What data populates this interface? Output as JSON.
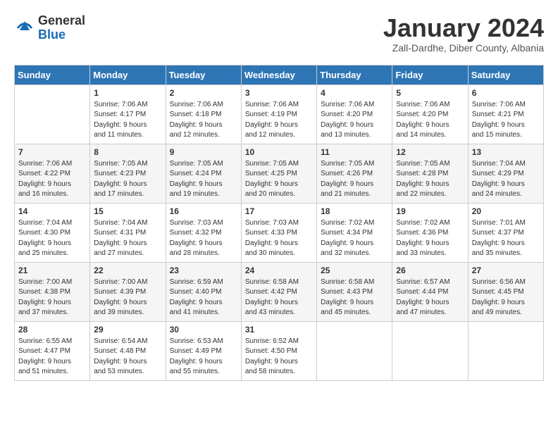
{
  "logo": {
    "general": "General",
    "blue": "Blue"
  },
  "title": "January 2024",
  "location": "Zall-Dardhe, Diber County, Albania",
  "days_of_week": [
    "Sunday",
    "Monday",
    "Tuesday",
    "Wednesday",
    "Thursday",
    "Friday",
    "Saturday"
  ],
  "weeks": [
    [
      {
        "day": "",
        "info": ""
      },
      {
        "day": "1",
        "info": "Sunrise: 7:06 AM\nSunset: 4:17 PM\nDaylight: 9 hours\nand 11 minutes."
      },
      {
        "day": "2",
        "info": "Sunrise: 7:06 AM\nSunset: 4:18 PM\nDaylight: 9 hours\nand 12 minutes."
      },
      {
        "day": "3",
        "info": "Sunrise: 7:06 AM\nSunset: 4:19 PM\nDaylight: 9 hours\nand 12 minutes."
      },
      {
        "day": "4",
        "info": "Sunrise: 7:06 AM\nSunset: 4:20 PM\nDaylight: 9 hours\nand 13 minutes."
      },
      {
        "day": "5",
        "info": "Sunrise: 7:06 AM\nSunset: 4:20 PM\nDaylight: 9 hours\nand 14 minutes."
      },
      {
        "day": "6",
        "info": "Sunrise: 7:06 AM\nSunset: 4:21 PM\nDaylight: 9 hours\nand 15 minutes."
      }
    ],
    [
      {
        "day": "7",
        "info": "Sunrise: 7:06 AM\nSunset: 4:22 PM\nDaylight: 9 hours\nand 16 minutes."
      },
      {
        "day": "8",
        "info": "Sunrise: 7:05 AM\nSunset: 4:23 PM\nDaylight: 9 hours\nand 17 minutes."
      },
      {
        "day": "9",
        "info": "Sunrise: 7:05 AM\nSunset: 4:24 PM\nDaylight: 9 hours\nand 19 minutes."
      },
      {
        "day": "10",
        "info": "Sunrise: 7:05 AM\nSunset: 4:25 PM\nDaylight: 9 hours\nand 20 minutes."
      },
      {
        "day": "11",
        "info": "Sunrise: 7:05 AM\nSunset: 4:26 PM\nDaylight: 9 hours\nand 21 minutes."
      },
      {
        "day": "12",
        "info": "Sunrise: 7:05 AM\nSunset: 4:28 PM\nDaylight: 9 hours\nand 22 minutes."
      },
      {
        "day": "13",
        "info": "Sunrise: 7:04 AM\nSunset: 4:29 PM\nDaylight: 9 hours\nand 24 minutes."
      }
    ],
    [
      {
        "day": "14",
        "info": "Sunrise: 7:04 AM\nSunset: 4:30 PM\nDaylight: 9 hours\nand 25 minutes."
      },
      {
        "day": "15",
        "info": "Sunrise: 7:04 AM\nSunset: 4:31 PM\nDaylight: 9 hours\nand 27 minutes."
      },
      {
        "day": "16",
        "info": "Sunrise: 7:03 AM\nSunset: 4:32 PM\nDaylight: 9 hours\nand 28 minutes."
      },
      {
        "day": "17",
        "info": "Sunrise: 7:03 AM\nSunset: 4:33 PM\nDaylight: 9 hours\nand 30 minutes."
      },
      {
        "day": "18",
        "info": "Sunrise: 7:02 AM\nSunset: 4:34 PM\nDaylight: 9 hours\nand 32 minutes."
      },
      {
        "day": "19",
        "info": "Sunrise: 7:02 AM\nSunset: 4:36 PM\nDaylight: 9 hours\nand 33 minutes."
      },
      {
        "day": "20",
        "info": "Sunrise: 7:01 AM\nSunset: 4:37 PM\nDaylight: 9 hours\nand 35 minutes."
      }
    ],
    [
      {
        "day": "21",
        "info": "Sunrise: 7:00 AM\nSunset: 4:38 PM\nDaylight: 9 hours\nand 37 minutes."
      },
      {
        "day": "22",
        "info": "Sunrise: 7:00 AM\nSunset: 4:39 PM\nDaylight: 9 hours\nand 39 minutes."
      },
      {
        "day": "23",
        "info": "Sunrise: 6:59 AM\nSunset: 4:40 PM\nDaylight: 9 hours\nand 41 minutes."
      },
      {
        "day": "24",
        "info": "Sunrise: 6:58 AM\nSunset: 4:42 PM\nDaylight: 9 hours\nand 43 minutes."
      },
      {
        "day": "25",
        "info": "Sunrise: 6:58 AM\nSunset: 4:43 PM\nDaylight: 9 hours\nand 45 minutes."
      },
      {
        "day": "26",
        "info": "Sunrise: 6:57 AM\nSunset: 4:44 PM\nDaylight: 9 hours\nand 47 minutes."
      },
      {
        "day": "27",
        "info": "Sunrise: 6:56 AM\nSunset: 4:45 PM\nDaylight: 9 hours\nand 49 minutes."
      }
    ],
    [
      {
        "day": "28",
        "info": "Sunrise: 6:55 AM\nSunset: 4:47 PM\nDaylight: 9 hours\nand 51 minutes."
      },
      {
        "day": "29",
        "info": "Sunrise: 6:54 AM\nSunset: 4:48 PM\nDaylight: 9 hours\nand 53 minutes."
      },
      {
        "day": "30",
        "info": "Sunrise: 6:53 AM\nSunset: 4:49 PM\nDaylight: 9 hours\nand 55 minutes."
      },
      {
        "day": "31",
        "info": "Sunrise: 6:52 AM\nSunset: 4:50 PM\nDaylight: 9 hours\nand 58 minutes."
      },
      {
        "day": "",
        "info": ""
      },
      {
        "day": "",
        "info": ""
      },
      {
        "day": "",
        "info": ""
      }
    ]
  ]
}
